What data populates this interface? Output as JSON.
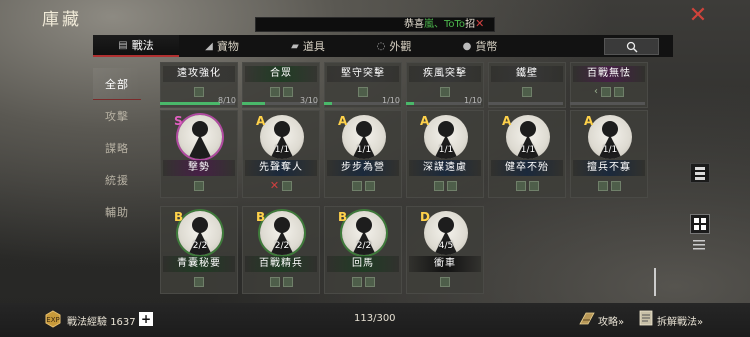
{
  "window": {
    "title": "庫藏"
  },
  "news": {
    "prefix": "恭喜",
    "highlight": "嵐、ToTo",
    "suffix": "招"
  },
  "tabs": [
    {
      "label": "戰法",
      "icon": "tactics-icon"
    },
    {
      "label": "寶物",
      "icon": "treasure-icon"
    },
    {
      "label": "道具",
      "icon": "item-icon"
    },
    {
      "label": "外觀",
      "icon": "appearance-icon"
    },
    {
      "label": "貨幣",
      "icon": "currency-icon"
    }
  ],
  "side_menu": [
    "全部",
    "攻擊",
    "謀略",
    "統援",
    "輔助"
  ],
  "top_cards": [
    {
      "name": "遠攻強化",
      "progress": "8/10",
      "fill": 0.8
    },
    {
      "name": "合眾",
      "progress": "3/10",
      "fill": 0.3
    },
    {
      "name": "堅守突擊",
      "progress": "1/10",
      "fill": 0.1
    },
    {
      "name": "疾風突擊",
      "progress": "1/10",
      "fill": 0.1
    },
    {
      "name": "鐵壁",
      "progress": "",
      "fill": 0
    },
    {
      "name": "百戰無怯",
      "progress": "",
      "fill": 0
    }
  ],
  "cards": [
    {
      "grade": "S",
      "name": "撃勢",
      "count": ""
    },
    {
      "grade": "A",
      "name": "先聲奪人",
      "count": "1/1"
    },
    {
      "grade": "A",
      "name": "步步為營",
      "count": "1/1"
    },
    {
      "grade": "A",
      "name": "深謀遠慮",
      "count": "1/1"
    },
    {
      "grade": "A",
      "name": "健卒不殆",
      "count": "1/1"
    },
    {
      "grade": "A",
      "name": "擅兵不寡",
      "count": "1/1"
    },
    {
      "grade": "B",
      "name": "青囊秘要",
      "count": "2/2"
    },
    {
      "grade": "B",
      "name": "百戰精兵",
      "count": "2/2"
    },
    {
      "grade": "B",
      "name": "回馬",
      "count": "2/2"
    },
    {
      "grade": "D",
      "name": "衝車",
      "count": "4/5"
    }
  ],
  "bottom": {
    "exp_label": "戰法經驗",
    "exp_value": "1637",
    "page_count": "113/300",
    "guide_label": "攻略»",
    "dismantle_label": "拆解戰法»"
  },
  "colors": {
    "accent_red": "#d0433b",
    "grade_s": "#e060c0",
    "grade_a": "#ffd24a",
    "grade_b": "#ffd24a",
    "progress": "#4ab86a"
  }
}
